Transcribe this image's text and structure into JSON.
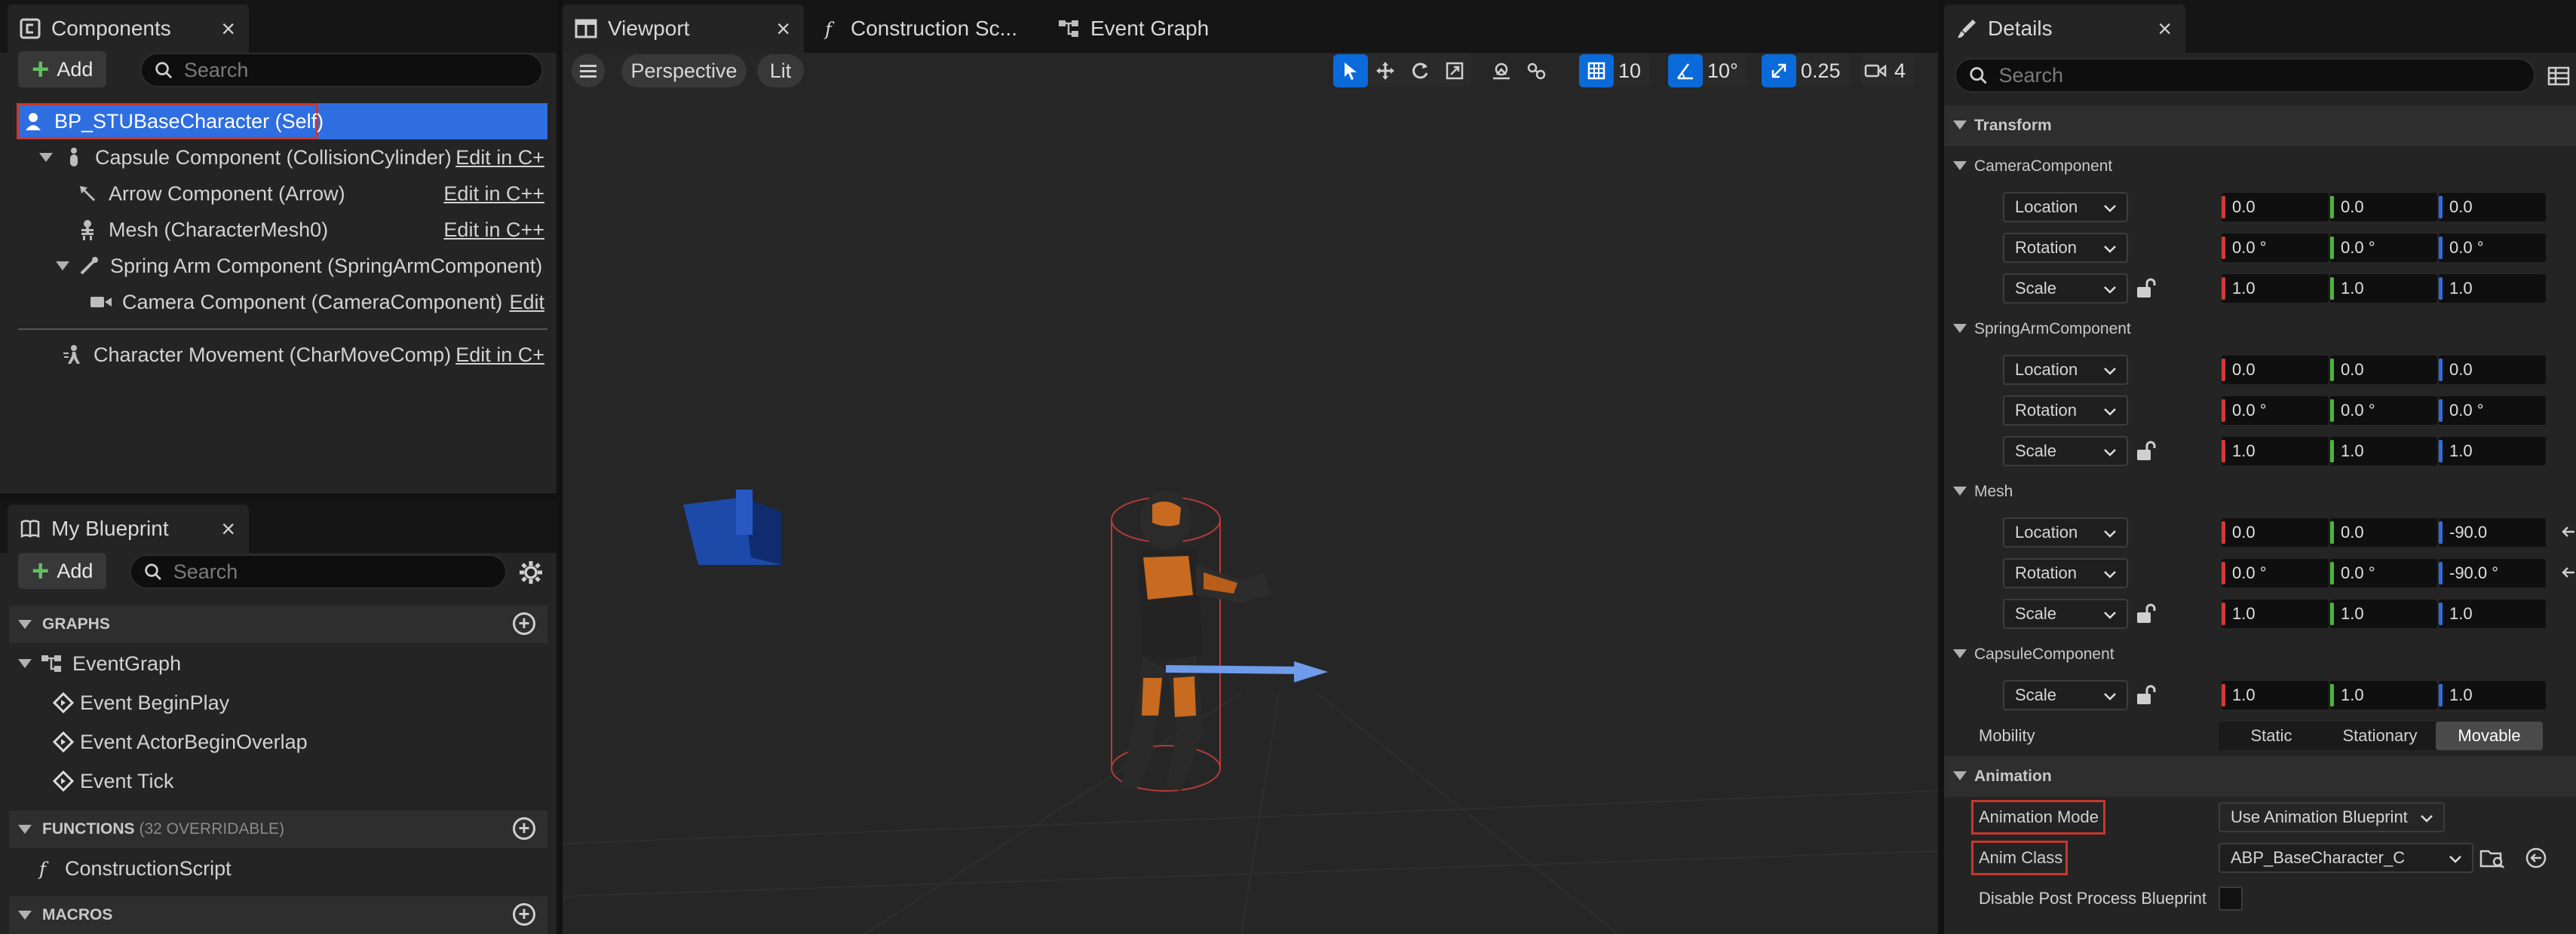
{
  "components": {
    "tab_title": "Components",
    "add_label": "Add",
    "search_placeholder": "Search",
    "root": "BP_STUBaseCharacter (Self)",
    "items": [
      {
        "label": "Capsule Component (CollisionCylinder)",
        "edit": "Edit in C+"
      },
      {
        "label": "Arrow Component (Arrow)",
        "edit": "Edit in C++"
      },
      {
        "label": "Mesh (CharacterMesh0)",
        "edit": "Edit in C++"
      },
      {
        "label": "Spring Arm Component (SpringArmComponent)",
        "edit": ""
      },
      {
        "label": "Camera Component (CameraComponent)",
        "edit": "Edit"
      },
      {
        "label": "Character Movement (CharMoveComp)",
        "edit": "Edit in C+"
      }
    ]
  },
  "my_blueprint": {
    "tab_title": "My Blueprint",
    "add_label": "Add",
    "search_placeholder": "Search",
    "graphs_label": "GRAPHS",
    "event_graph": "EventGraph",
    "events": [
      "Event BeginPlay",
      "Event ActorBeginOverlap",
      "Event Tick"
    ],
    "functions_label": "FUNCTIONS",
    "functions_count": "(32 OVERRIDABLE)",
    "construction_script": "ConstructionScript",
    "macros_label": "MACROS"
  },
  "editor_tabs": {
    "viewport": "Viewport",
    "construction": "Construction Sc...",
    "event_graph": "Event Graph"
  },
  "viewport": {
    "perspective": "Perspective",
    "lit": "Lit",
    "grid_snap": "10",
    "rotation_snap": "10°",
    "scale_snap": "0.25",
    "camera_speed": "4"
  },
  "details": {
    "tab_title": "Details",
    "search_placeholder": "Search",
    "transform_label": "Transform",
    "camera_component": "CameraComponent",
    "spring_arm_component": "SpringArmComponent",
    "mesh": "Mesh",
    "capsule_component": "CapsuleComponent",
    "location": "Location",
    "rotation": "Rotation",
    "scale": "Scale",
    "camera_values": {
      "loc": [
        "0.0",
        "0.0",
        "0.0"
      ],
      "rot": [
        "0.0 °",
        "0.0 °",
        "0.0 °"
      ],
      "scale": [
        "1.0",
        "1.0",
        "1.0"
      ]
    },
    "spring_values": {
      "loc": [
        "0.0",
        "0.0",
        "0.0"
      ],
      "rot": [
        "0.0 °",
        "0.0 °",
        "0.0 °"
      ],
      "scale": [
        "1.0",
        "1.0",
        "1.0"
      ]
    },
    "mesh_values": {
      "loc": [
        "0.0",
        "0.0",
        "-90.0"
      ],
      "rot": [
        "0.0 °",
        "0.0 °",
        "-90.0 °"
      ],
      "scale": [
        "1.0",
        "1.0",
        "1.0"
      ]
    },
    "capsule_scale": [
      "1.0",
      "1.0",
      "1.0"
    ],
    "mobility_label": "Mobility",
    "mobility_options": [
      "Static",
      "Stationary",
      "Movable"
    ],
    "animation_label": "Animation",
    "animation_mode_label": "Animation Mode",
    "animation_mode_value": "Use Animation Blueprint",
    "anim_class_label": "Anim Class",
    "anim_class_value": "ABP_BaseCharacter_C",
    "disable_post_label": "Disable Post Process Blueprint"
  },
  "colors": {
    "selection": "#2f6ee0",
    "highlight_box": "#c8372c",
    "axis_x": "#d33a3a",
    "axis_y": "#4fb33c",
    "axis_z": "#2f6ee0",
    "toggle_on": "#0a6ad9"
  }
}
